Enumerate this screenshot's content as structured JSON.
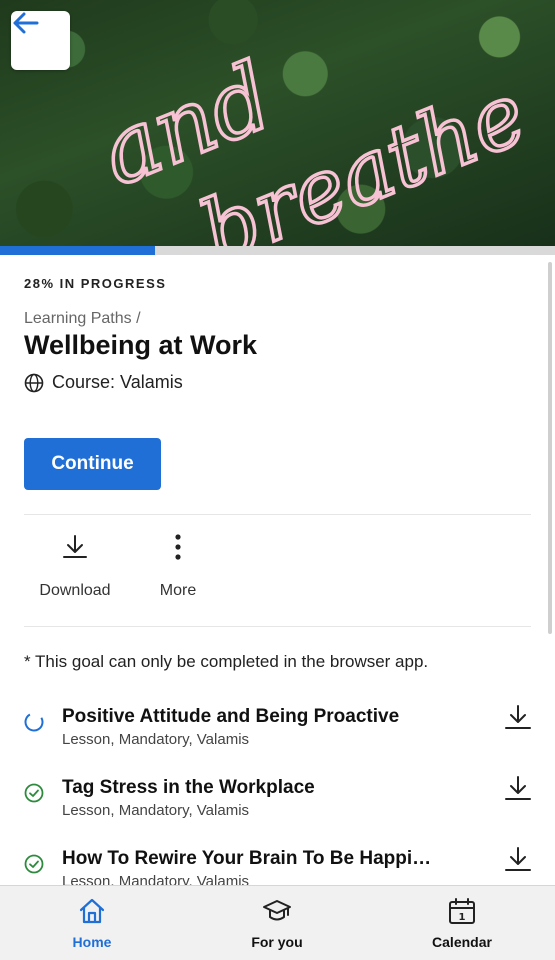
{
  "hero": {
    "neon_text_line1": "and",
    "neon_text_line2": "breathe"
  },
  "progress": {
    "percent": 28,
    "label": "28% IN PROGRESS"
  },
  "breadcrumb": "Learning Paths /",
  "title": "Wellbeing at Work",
  "course": {
    "icon": "globe-icon",
    "label": "Course: Valamis"
  },
  "continue_label": "Continue",
  "actions": [
    {
      "icon": "download-icon",
      "label": "Download"
    },
    {
      "icon": "more-vertical-icon",
      "label": "More"
    }
  ],
  "note": "* This goal can only be completed in the browser app.",
  "items": [
    {
      "status": "in-progress",
      "title": "Positive Attitude and Being Proactive",
      "subtitle": "Lesson, Mandatory, Valamis"
    },
    {
      "status": "completed",
      "title": "Tag Stress in the Workplace",
      "subtitle": "Lesson, Mandatory, Valamis"
    },
    {
      "status": "completed",
      "title": "How To Rewire Your Brain To Be Happi…",
      "subtitle": "Lesson, Mandatory, Valamis"
    }
  ],
  "nav": [
    {
      "icon": "home-icon",
      "label": "Home",
      "active": true
    },
    {
      "icon": "graduation-cap-icon",
      "label": "For you",
      "active": false
    },
    {
      "icon": "calendar-icon",
      "label": "Calendar",
      "active": false
    }
  ],
  "colors": {
    "accent": "#1f6fd6",
    "success": "#2e8b3e",
    "neon": "#f7c2d4"
  }
}
